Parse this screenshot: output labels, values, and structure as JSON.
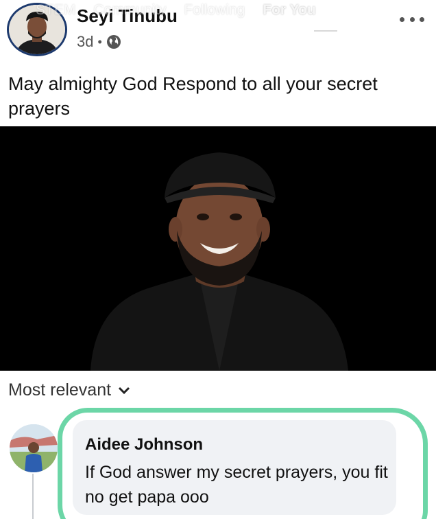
{
  "overlay_nav": {
    "items": [
      "STEM",
      "Community",
      "Following",
      "For You"
    ],
    "active_index": 3
  },
  "post": {
    "author": "Seyi Tinubu",
    "time": "3d",
    "visibility_icon": "globe-icon",
    "menu_icon": "more-horizontal-icon",
    "text": "May almighty God Respond to all your secret prayers"
  },
  "comments": {
    "sort_label": "Most relevant",
    "sort_icon": "chevron-down-icon",
    "items": [
      {
        "author": "Aidee Johnson",
        "text": "If God answer my secret prayers, you fit no get papa ooo"
      }
    ]
  },
  "colors": {
    "highlight": "#5fd2a0",
    "avatar_ring": "#1d3a6e",
    "bubble": "#f0f2f5"
  }
}
